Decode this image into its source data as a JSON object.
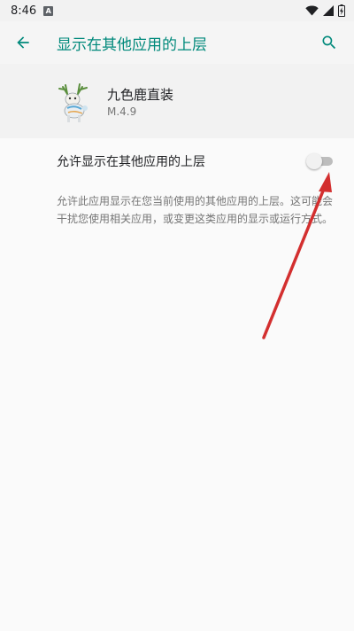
{
  "status_bar": {
    "time": "8:46",
    "notification_icon": "a-letter-icon",
    "icons": [
      "wifi-icon",
      "signal-icon",
      "battery-charging-icon"
    ]
  },
  "app_bar": {
    "title": "显示在其他应用的上层",
    "back_icon": "arrow-back-icon",
    "search_icon": "search-icon",
    "accent_color": "#00897b"
  },
  "app": {
    "name": "九色鹿直装",
    "version": "M.4.9"
  },
  "setting": {
    "label": "允许显示在其他应用的上层",
    "toggle_on": false
  },
  "description": "允许此应用显示在您当前使用的其他应用的上层。这可能会干扰您使用相关应用，或变更这类应用的显示或运行方式。",
  "annotation": {
    "arrow_color": "#d32f2f"
  }
}
